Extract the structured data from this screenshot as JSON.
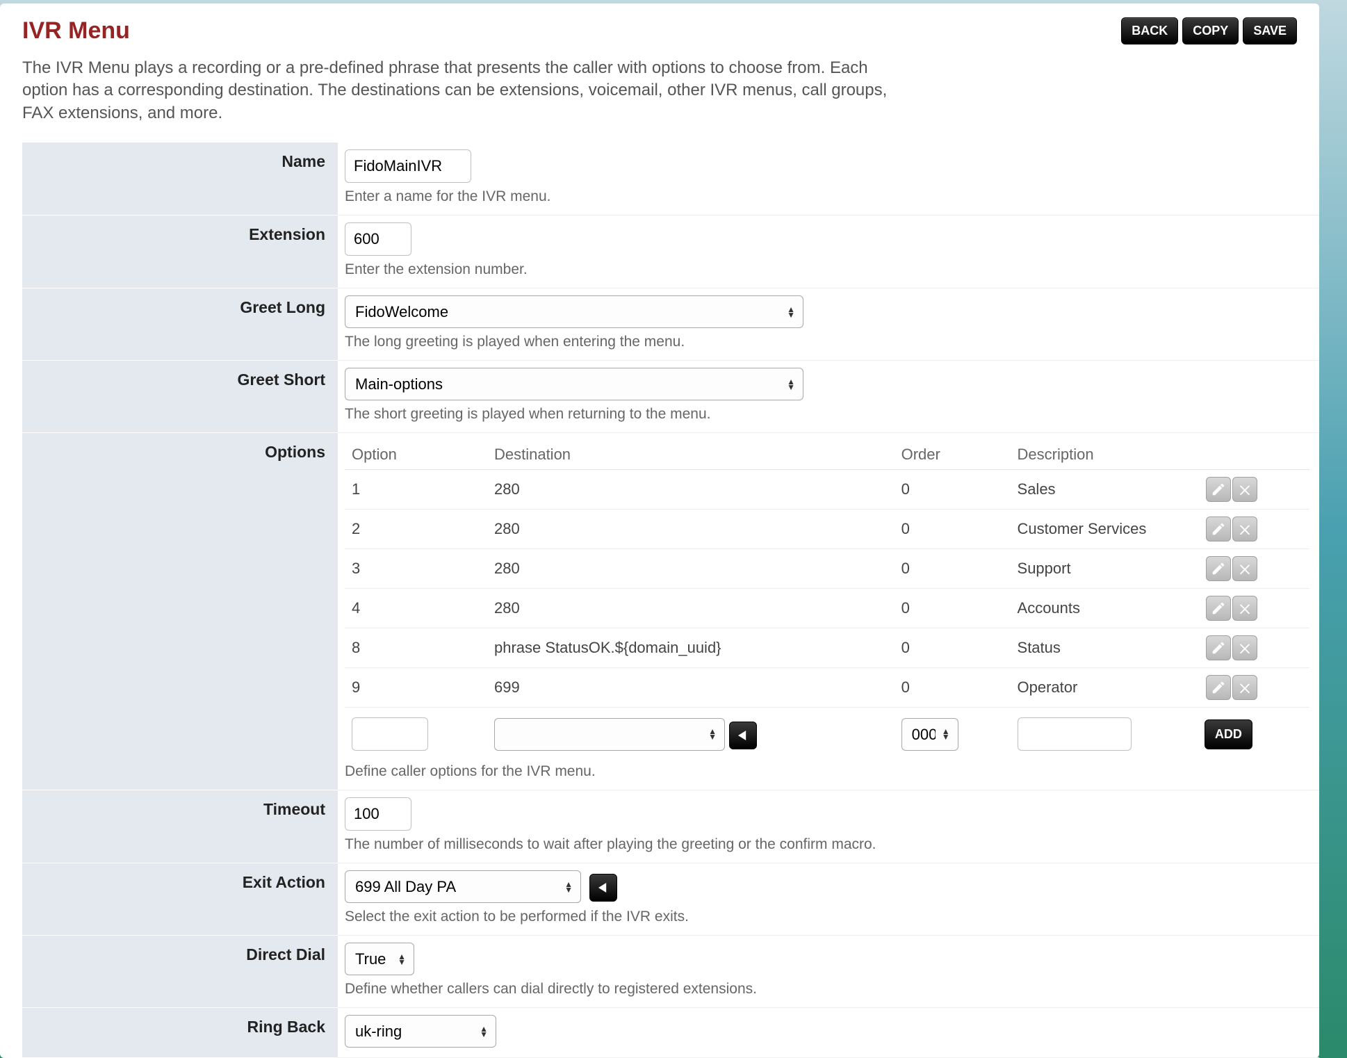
{
  "header": {
    "title": "IVR Menu",
    "back": "BACK",
    "copy": "COPY",
    "save": "SAVE"
  },
  "description": "The IVR Menu plays a recording or a pre-defined phrase that presents the caller with options to choose from. Each option has a corresponding destination. The destinations can be extensions, voicemail, other IVR menus, call groups, FAX extensions, and more.",
  "fields": {
    "name": {
      "label": "Name",
      "value": "FidoMainIVR",
      "helper": "Enter a name for the IVR menu."
    },
    "extension": {
      "label": "Extension",
      "value": "600",
      "helper": "Enter the extension number."
    },
    "greet_long": {
      "label": "Greet Long",
      "value": "FidoWelcome",
      "helper": "The long greeting is played when entering the menu."
    },
    "greet_short": {
      "label": "Greet Short",
      "value": "Main-options",
      "helper": "The short greeting is played when returning to the menu."
    },
    "options": {
      "label": "Options",
      "cols": {
        "option": "Option",
        "destination": "Destination",
        "order": "Order",
        "description": "Description"
      },
      "rows": [
        {
          "option": "1",
          "destination": "280",
          "order": "0",
          "description": "Sales"
        },
        {
          "option": "2",
          "destination": "280",
          "order": "0",
          "description": "Customer Services"
        },
        {
          "option": "3",
          "destination": "280",
          "order": "0",
          "description": "Support"
        },
        {
          "option": "4",
          "destination": "280",
          "order": "0",
          "description": "Accounts"
        },
        {
          "option": "8",
          "destination": "phrase StatusOK.${domain_uuid}",
          "order": "0",
          "description": "Status"
        },
        {
          "option": "9",
          "destination": "699",
          "order": "0",
          "description": "Operator"
        }
      ],
      "new": {
        "option": "",
        "destination": "",
        "order": "000",
        "description": "",
        "add": "ADD"
      },
      "helper": "Define caller options for the IVR menu."
    },
    "timeout": {
      "label": "Timeout",
      "value": "100",
      "helper": "The number of milliseconds to wait after playing the greeting or the confirm macro."
    },
    "exit_action": {
      "label": "Exit Action",
      "value": "699 All Day PA",
      "helper": "Select the exit action to be performed if the IVR exits."
    },
    "direct_dial": {
      "label": "Direct Dial",
      "value": "True",
      "helper": "Define whether callers can dial directly to registered extensions."
    },
    "ring_back": {
      "label": "Ring Back",
      "value": "uk-ring"
    }
  }
}
